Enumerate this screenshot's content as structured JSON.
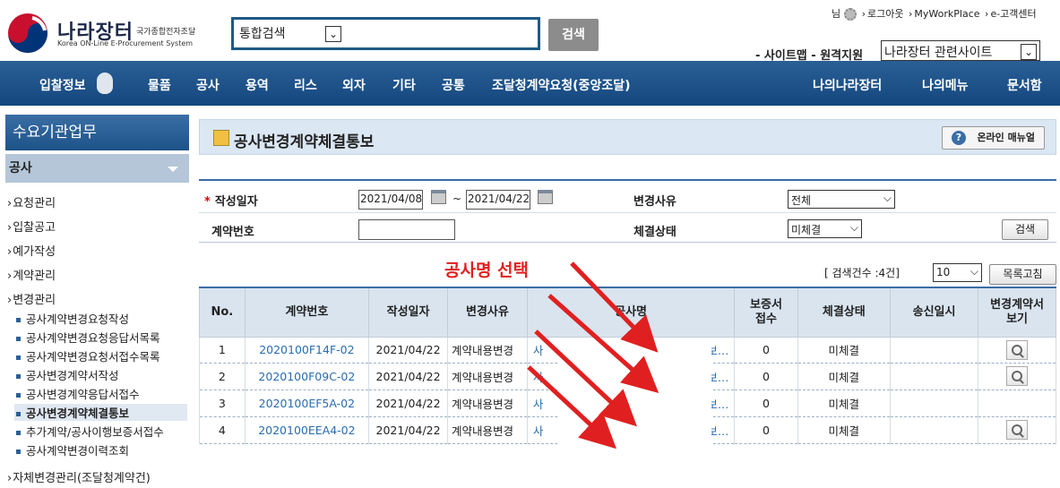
{
  "header": {
    "logo_title": "나라장터",
    "logo_sub_ko": "국가종합전자조달",
    "logo_sub_en": "Korea ON-Line E-Procurement System",
    "search_scope": "통합검색",
    "search_button": "검색",
    "util_links": [
      "님",
      "로그아웃",
      "MyWorkPlace",
      "e-고객센터"
    ],
    "site_links": "- 사이트맵 - 원격지원",
    "related_sites": "나라장터 관련사이트"
  },
  "nav": {
    "items": [
      "입찰정보",
      "물품",
      "공사",
      "용역",
      "리스",
      "외자",
      "기타",
      "공통",
      "조달청계약요청(중앙조달)",
      "나의나라장터",
      "나의메뉴",
      "문서함"
    ]
  },
  "sidebar": {
    "title": "수요기관업무",
    "section": "공사",
    "items": [
      "요청관리",
      "입찰공고",
      "예가작성",
      "계약관리",
      "변경관리"
    ],
    "subitems": [
      "공사계약변경요청작성",
      "공사계약변경요청응답서목록",
      "공사계약변경요청서접수목록",
      "공사변경계약서작성",
      "공사변경계약응답서접수",
      "공사변경계약체결통보",
      "추가계약/공사이행보증서접수",
      "공사계약변경이력조회"
    ],
    "active_subitem": "공사변경계약체결통보",
    "last_item": "자체변경관리(조달청계약건)"
  },
  "page": {
    "title": "공사변경계약체결통보",
    "manual_button": "온라인 매뉴얼"
  },
  "form": {
    "date_label": "작성일자",
    "date_from": "2021/04/08",
    "date_to": "2021/04/22",
    "date_sep": "~",
    "reason_label": "변경사유",
    "reason_value": "전체",
    "contract_label": "계약번호",
    "contract_value": "",
    "status_label": "체결상태",
    "status_value": "미체결",
    "search_button": "검색"
  },
  "results": {
    "count_text": "[ 검색건수 :4건]",
    "page_size": "10",
    "refresh_button": "목록고침",
    "headers": [
      "No.",
      "계약번호",
      "작성일자",
      "변경사유",
      "공사명",
      "보증서\n접수",
      "체결상태",
      "송신일시",
      "변경계약서\n보기"
    ],
    "rows": [
      {
        "no": "1",
        "contract": "2020100F14F-02",
        "date": "2021/04/22",
        "reason": "계약내용변경",
        "name_start": "사",
        "name_end": "보…",
        "bond": "0",
        "status": "미체결",
        "sent": "",
        "has_view": true
      },
      {
        "no": "2",
        "contract": "2020100F09C-02",
        "date": "2021/04/22",
        "reason": "계약내용변경",
        "name_start": "사",
        "name_end": "보…",
        "bond": "0",
        "status": "미체결",
        "sent": "",
        "has_view": true
      },
      {
        "no": "3",
        "contract": "2020100EF5A-02",
        "date": "2021/04/22",
        "reason": "계약내용변경",
        "name_start": "사",
        "name_end": "보…",
        "bond": "0",
        "status": "미체결",
        "sent": "",
        "has_view": false
      },
      {
        "no": "4",
        "contract": "2020100EEA4-02",
        "date": "2021/04/22",
        "reason": "계약내용변경",
        "name_start": "사",
        "name_end": "보…",
        "bond": "0",
        "status": "미체결",
        "sent": "",
        "has_view": true
      }
    ]
  },
  "annotation": {
    "label": "공사명 선택",
    "color": "#e02020"
  }
}
